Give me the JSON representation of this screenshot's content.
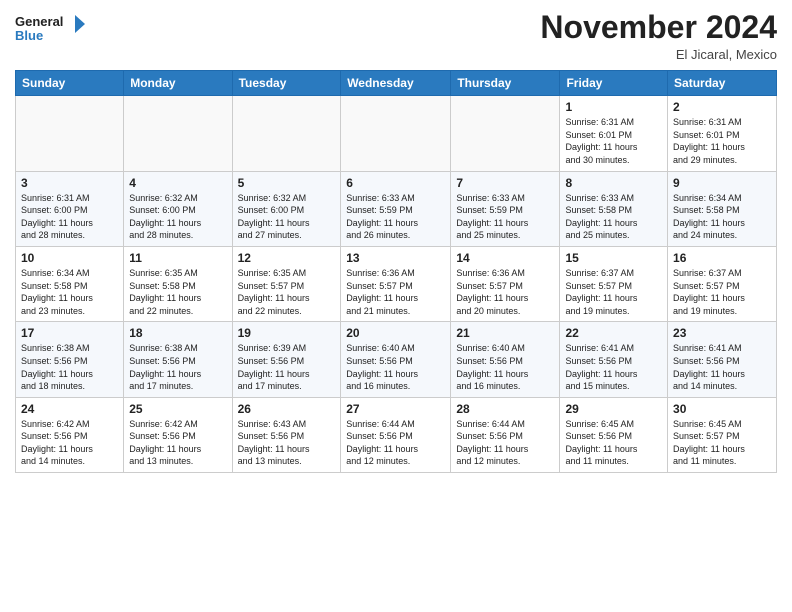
{
  "header": {
    "logo_line1": "General",
    "logo_line2": "Blue",
    "month_title": "November 2024",
    "location": "El Jicaral, Mexico"
  },
  "weekdays": [
    "Sunday",
    "Monday",
    "Tuesday",
    "Wednesday",
    "Thursday",
    "Friday",
    "Saturday"
  ],
  "weeks": [
    [
      {
        "day": "",
        "content": ""
      },
      {
        "day": "",
        "content": ""
      },
      {
        "day": "",
        "content": ""
      },
      {
        "day": "",
        "content": ""
      },
      {
        "day": "",
        "content": ""
      },
      {
        "day": "1",
        "content": "Sunrise: 6:31 AM\nSunset: 6:01 PM\nDaylight: 11 hours\nand 30 minutes."
      },
      {
        "day": "2",
        "content": "Sunrise: 6:31 AM\nSunset: 6:01 PM\nDaylight: 11 hours\nand 29 minutes."
      }
    ],
    [
      {
        "day": "3",
        "content": "Sunrise: 6:31 AM\nSunset: 6:00 PM\nDaylight: 11 hours\nand 28 minutes."
      },
      {
        "day": "4",
        "content": "Sunrise: 6:32 AM\nSunset: 6:00 PM\nDaylight: 11 hours\nand 28 minutes."
      },
      {
        "day": "5",
        "content": "Sunrise: 6:32 AM\nSunset: 6:00 PM\nDaylight: 11 hours\nand 27 minutes."
      },
      {
        "day": "6",
        "content": "Sunrise: 6:33 AM\nSunset: 5:59 PM\nDaylight: 11 hours\nand 26 minutes."
      },
      {
        "day": "7",
        "content": "Sunrise: 6:33 AM\nSunset: 5:59 PM\nDaylight: 11 hours\nand 25 minutes."
      },
      {
        "day": "8",
        "content": "Sunrise: 6:33 AM\nSunset: 5:58 PM\nDaylight: 11 hours\nand 25 minutes."
      },
      {
        "day": "9",
        "content": "Sunrise: 6:34 AM\nSunset: 5:58 PM\nDaylight: 11 hours\nand 24 minutes."
      }
    ],
    [
      {
        "day": "10",
        "content": "Sunrise: 6:34 AM\nSunset: 5:58 PM\nDaylight: 11 hours\nand 23 minutes."
      },
      {
        "day": "11",
        "content": "Sunrise: 6:35 AM\nSunset: 5:58 PM\nDaylight: 11 hours\nand 22 minutes."
      },
      {
        "day": "12",
        "content": "Sunrise: 6:35 AM\nSunset: 5:57 PM\nDaylight: 11 hours\nand 22 minutes."
      },
      {
        "day": "13",
        "content": "Sunrise: 6:36 AM\nSunset: 5:57 PM\nDaylight: 11 hours\nand 21 minutes."
      },
      {
        "day": "14",
        "content": "Sunrise: 6:36 AM\nSunset: 5:57 PM\nDaylight: 11 hours\nand 20 minutes."
      },
      {
        "day": "15",
        "content": "Sunrise: 6:37 AM\nSunset: 5:57 PM\nDaylight: 11 hours\nand 19 minutes."
      },
      {
        "day": "16",
        "content": "Sunrise: 6:37 AM\nSunset: 5:57 PM\nDaylight: 11 hours\nand 19 minutes."
      }
    ],
    [
      {
        "day": "17",
        "content": "Sunrise: 6:38 AM\nSunset: 5:56 PM\nDaylight: 11 hours\nand 18 minutes."
      },
      {
        "day": "18",
        "content": "Sunrise: 6:38 AM\nSunset: 5:56 PM\nDaylight: 11 hours\nand 17 minutes."
      },
      {
        "day": "19",
        "content": "Sunrise: 6:39 AM\nSunset: 5:56 PM\nDaylight: 11 hours\nand 17 minutes."
      },
      {
        "day": "20",
        "content": "Sunrise: 6:40 AM\nSunset: 5:56 PM\nDaylight: 11 hours\nand 16 minutes."
      },
      {
        "day": "21",
        "content": "Sunrise: 6:40 AM\nSunset: 5:56 PM\nDaylight: 11 hours\nand 16 minutes."
      },
      {
        "day": "22",
        "content": "Sunrise: 6:41 AM\nSunset: 5:56 PM\nDaylight: 11 hours\nand 15 minutes."
      },
      {
        "day": "23",
        "content": "Sunrise: 6:41 AM\nSunset: 5:56 PM\nDaylight: 11 hours\nand 14 minutes."
      }
    ],
    [
      {
        "day": "24",
        "content": "Sunrise: 6:42 AM\nSunset: 5:56 PM\nDaylight: 11 hours\nand 14 minutes."
      },
      {
        "day": "25",
        "content": "Sunrise: 6:42 AM\nSunset: 5:56 PM\nDaylight: 11 hours\nand 13 minutes."
      },
      {
        "day": "26",
        "content": "Sunrise: 6:43 AM\nSunset: 5:56 PM\nDaylight: 11 hours\nand 13 minutes."
      },
      {
        "day": "27",
        "content": "Sunrise: 6:44 AM\nSunset: 5:56 PM\nDaylight: 11 hours\nand 12 minutes."
      },
      {
        "day": "28",
        "content": "Sunrise: 6:44 AM\nSunset: 5:56 PM\nDaylight: 11 hours\nand 12 minutes."
      },
      {
        "day": "29",
        "content": "Sunrise: 6:45 AM\nSunset: 5:56 PM\nDaylight: 11 hours\nand 11 minutes."
      },
      {
        "day": "30",
        "content": "Sunrise: 6:45 AM\nSunset: 5:57 PM\nDaylight: 11 hours\nand 11 minutes."
      }
    ]
  ]
}
